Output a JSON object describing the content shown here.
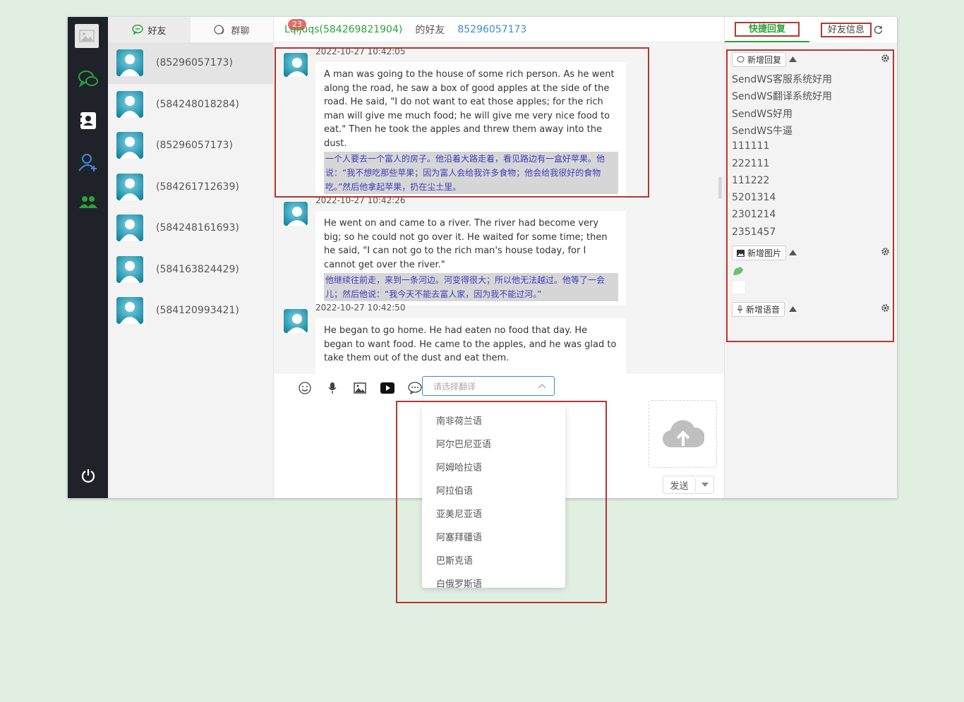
{
  "contacts": {
    "tabs": [
      {
        "label": "好友",
        "active": true
      },
      {
        "label": "群聊",
        "badge": "23"
      }
    ],
    "items": [
      {
        "name": "(85296057173)",
        "active": true
      },
      {
        "name": "(584248018284)"
      },
      {
        "name": "(85296057173)"
      },
      {
        "name": "(584261712639)"
      },
      {
        "name": "(584248161693)"
      },
      {
        "name": "(584163824429)"
      },
      {
        "name": "(584120993421)"
      }
    ]
  },
  "chat": {
    "header": {
      "account": "Lqijuqs(584269821904)",
      "of_friend": "的好友",
      "friend_id": "85296057173"
    },
    "messages": [
      {
        "time": "2022-10-27 10:42:05",
        "en": "A man was going to the house of some rich person. As he went along the road, he saw a box of good apples at the side of the road. He said, \"I do not want to eat those apples; for the rich man will give me much food; he will give me very nice food to eat.\" Then he took the apples and threw them away into the dust.",
        "cn": "一个人要去一个富人的房子。他沿着大路走着，看见路边有一盒好苹果。他说：“我不想吃那些苹果；因为富人会给我许多食物；他会给我很好的食物吃。”然后他拿起苹果，扔在尘土里。"
      },
      {
        "time": "2022-10-27 10:42:26",
        "en": "He went on and came to a river. The river had become very big; so he could not go over it. He waited for some time; then he said, \"I can not go to the rich man's house today, for I cannot get over the river.\"",
        "cn": "他继续往前走，来到一条河边。河变得很大；所以他无法越过。他等了一会儿；然后他说：“我今天不能去富人家，因为我不能过河。”"
      },
      {
        "time": "2022-10-27 10:42:50",
        "en": "He began to go home. He had eaten no food that day. He began to want food. He came to the apples, and he was glad to take them out of the dust and eat them.",
        "cn": ""
      }
    ],
    "translate_placeholder": "请选择翻译",
    "send_label": "发送"
  },
  "translate_options": [
    "南非荷兰语",
    "阿尔巴尼亚语",
    "阿姆哈拉语",
    "阿拉伯语",
    "亚美尼亚语",
    "阿塞拜疆语",
    "巴斯克语",
    "白俄罗斯语"
  ],
  "right_panel": {
    "tabs": [
      "快捷回复",
      "好友信息"
    ],
    "new_reply": "新增回复",
    "replies": [
      "SendWS客服系统好用",
      "SendWS翻译系统好用",
      "SendWS好用",
      "SendWS牛逼",
      "111111",
      "222111",
      "111222",
      "5201314",
      "2301214",
      "2351457"
    ],
    "new_image": "新增图片",
    "new_voice": "新增语音"
  },
  "colors": {
    "accent_green": "#2aa33b",
    "link_blue": "#3d8bd8",
    "annotation_red": "#b4372f",
    "rail": "#1f2329",
    "badge": "#e56a6a"
  }
}
